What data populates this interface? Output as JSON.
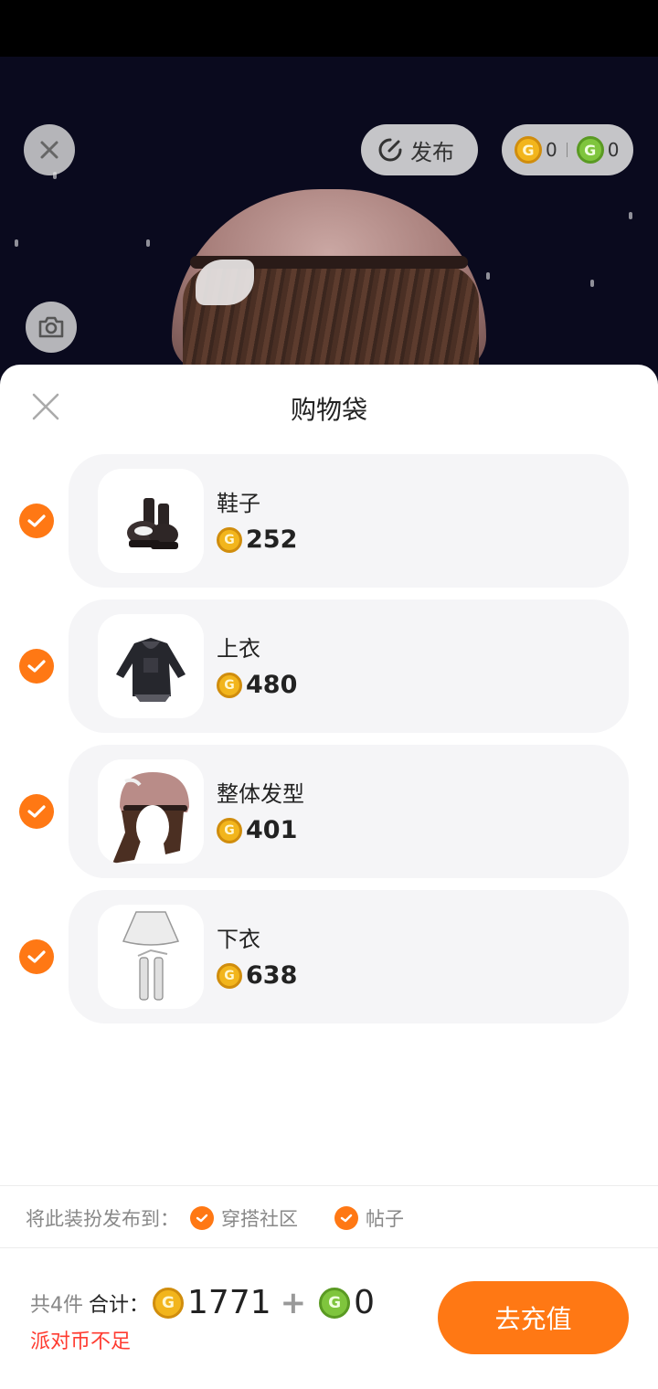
{
  "header": {
    "publish_label": "发布",
    "gold_balance": "0",
    "green_balance": "0"
  },
  "sheet": {
    "title": "购物袋",
    "items": [
      {
        "name": "鞋子",
        "price": "252"
      },
      {
        "name": "上衣",
        "price": "480"
      },
      {
        "name": "整体发型",
        "price": "401"
      },
      {
        "name": "下衣",
        "price": "638"
      }
    ],
    "publish_to_label": "将此装扮发布到：",
    "publish_options": [
      "穿搭社区",
      "帖子"
    ]
  },
  "footer": {
    "count_label": "共4件",
    "total_label": "合计：",
    "gold_total": "1771",
    "plus": "+",
    "green_total": "0",
    "warning": "派对币不足",
    "recharge_label": "去充值"
  },
  "colors": {
    "accent": "#ff7814",
    "warning": "#ff3b30",
    "gold_coin": "#f2b51c",
    "green_coin": "#7fc53d"
  },
  "icons": [
    "close-icon",
    "publish-icon",
    "camera-icon",
    "gold-coin-icon",
    "green-coin-icon",
    "check-icon"
  ]
}
